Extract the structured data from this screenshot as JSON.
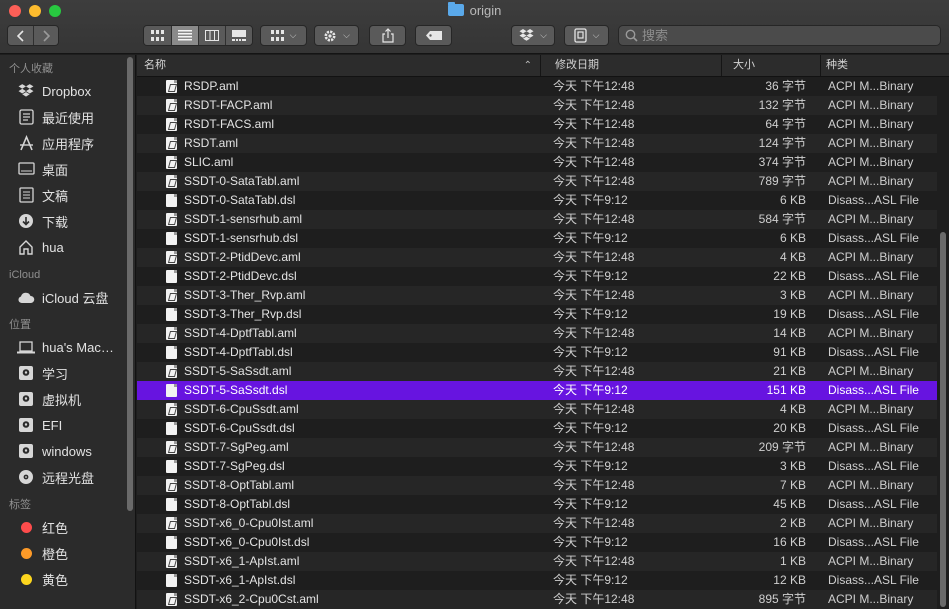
{
  "window": {
    "title": "origin"
  },
  "toolbar": {
    "search_placeholder": "搜索"
  },
  "sidebar": {
    "sections": {
      "favorites": "个人收藏",
      "icloud": "iCloud",
      "locations": "位置",
      "tags": "标签"
    },
    "favorites": [
      {
        "label": "Dropbox",
        "icon": "dropbox-icon"
      },
      {
        "label": "最近使用",
        "icon": "recents-icon"
      },
      {
        "label": "应用程序",
        "icon": "applications-icon"
      },
      {
        "label": "桌面",
        "icon": "desktop-icon"
      },
      {
        "label": "文稿",
        "icon": "documents-icon"
      },
      {
        "label": "下载",
        "icon": "downloads-icon"
      },
      {
        "label": "hua",
        "icon": "home-icon"
      }
    ],
    "icloud": [
      {
        "label": "iCloud 云盘",
        "icon": "cloud-icon"
      }
    ],
    "locations": [
      {
        "label": "hua's Mac…",
        "icon": "laptop-icon"
      },
      {
        "label": "学习",
        "icon": "disk-icon"
      },
      {
        "label": "虚拟机",
        "icon": "disk-icon"
      },
      {
        "label": "EFI",
        "icon": "disk-icon"
      },
      {
        "label": "windows",
        "icon": "disk-icon"
      },
      {
        "label": "远程光盘",
        "icon": "optical-disc-icon"
      }
    ],
    "tags": [
      {
        "label": "红色",
        "color": "#fe4c4c"
      },
      {
        "label": "橙色",
        "color": "#fd9a28"
      },
      {
        "label": "黄色",
        "color": "#fdd61e"
      }
    ]
  },
  "columns": {
    "name": "名称",
    "date": "修改日期",
    "size": "大小",
    "kind": "种类"
  },
  "files": [
    {
      "name": "RSDP.aml",
      "date": "今天 下午12:48",
      "size": "36 字节",
      "kind": "ACPI M...Binary",
      "type": "aml"
    },
    {
      "name": "RSDT-FACP.aml",
      "date": "今天 下午12:48",
      "size": "132 字节",
      "kind": "ACPI M...Binary",
      "type": "aml"
    },
    {
      "name": "RSDT-FACS.aml",
      "date": "今天 下午12:48",
      "size": "64 字节",
      "kind": "ACPI M...Binary",
      "type": "aml"
    },
    {
      "name": "RSDT.aml",
      "date": "今天 下午12:48",
      "size": "124 字节",
      "kind": "ACPI M...Binary",
      "type": "aml"
    },
    {
      "name": "SLIC.aml",
      "date": "今天 下午12:48",
      "size": "374 字节",
      "kind": "ACPI M...Binary",
      "type": "aml"
    },
    {
      "name": "SSDT-0-SataTabl.aml",
      "date": "今天 下午12:48",
      "size": "789 字节",
      "kind": "ACPI M...Binary",
      "type": "aml"
    },
    {
      "name": "SSDT-0-SataTabl.dsl",
      "date": "今天 下午9:12",
      "size": "6 KB",
      "kind": "Disass...ASL File",
      "type": "dsl"
    },
    {
      "name": "SSDT-1-sensrhub.aml",
      "date": "今天 下午12:48",
      "size": "584 字节",
      "kind": "ACPI M...Binary",
      "type": "aml"
    },
    {
      "name": "SSDT-1-sensrhub.dsl",
      "date": "今天 下午9:12",
      "size": "6 KB",
      "kind": "Disass...ASL File",
      "type": "dsl"
    },
    {
      "name": "SSDT-2-PtidDevc.aml",
      "date": "今天 下午12:48",
      "size": "4 KB",
      "kind": "ACPI M...Binary",
      "type": "aml"
    },
    {
      "name": "SSDT-2-PtidDevc.dsl",
      "date": "今天 下午9:12",
      "size": "22 KB",
      "kind": "Disass...ASL File",
      "type": "dsl"
    },
    {
      "name": "SSDT-3-Ther_Rvp.aml",
      "date": "今天 下午12:48",
      "size": "3 KB",
      "kind": "ACPI M...Binary",
      "type": "aml"
    },
    {
      "name": "SSDT-3-Ther_Rvp.dsl",
      "date": "今天 下午9:12",
      "size": "19 KB",
      "kind": "Disass...ASL File",
      "type": "dsl"
    },
    {
      "name": "SSDT-4-DptfTabl.aml",
      "date": "今天 下午12:48",
      "size": "14 KB",
      "kind": "ACPI M...Binary",
      "type": "aml"
    },
    {
      "name": "SSDT-4-DptfTabl.dsl",
      "date": "今天 下午9:12",
      "size": "91 KB",
      "kind": "Disass...ASL File",
      "type": "dsl"
    },
    {
      "name": "SSDT-5-SaSsdt.aml",
      "date": "今天 下午12:48",
      "size": "21 KB",
      "kind": "ACPI M...Binary",
      "type": "aml"
    },
    {
      "name": "SSDT-5-SaSsdt.dsl",
      "date": "今天 下午9:12",
      "size": "151 KB",
      "kind": "Disass...ASL File",
      "type": "dsl",
      "selected": true
    },
    {
      "name": "SSDT-6-CpuSsdt.aml",
      "date": "今天 下午12:48",
      "size": "4 KB",
      "kind": "ACPI M...Binary",
      "type": "aml"
    },
    {
      "name": "SSDT-6-CpuSsdt.dsl",
      "date": "今天 下午9:12",
      "size": "20 KB",
      "kind": "Disass...ASL File",
      "type": "dsl"
    },
    {
      "name": "SSDT-7-SgPeg.aml",
      "date": "今天 下午12:48",
      "size": "209 字节",
      "kind": "ACPI M...Binary",
      "type": "aml"
    },
    {
      "name": "SSDT-7-SgPeg.dsl",
      "date": "今天 下午9:12",
      "size": "3 KB",
      "kind": "Disass...ASL File",
      "type": "dsl"
    },
    {
      "name": "SSDT-8-OptTabl.aml",
      "date": "今天 下午12:48",
      "size": "7 KB",
      "kind": "ACPI M...Binary",
      "type": "aml"
    },
    {
      "name": "SSDT-8-OptTabl.dsl",
      "date": "今天 下午9:12",
      "size": "45 KB",
      "kind": "Disass...ASL File",
      "type": "dsl"
    },
    {
      "name": "SSDT-x6_0-Cpu0Ist.aml",
      "date": "今天 下午12:48",
      "size": "2 KB",
      "kind": "ACPI M...Binary",
      "type": "aml"
    },
    {
      "name": "SSDT-x6_0-Cpu0Ist.dsl",
      "date": "今天 下午9:12",
      "size": "16 KB",
      "kind": "Disass...ASL File",
      "type": "dsl"
    },
    {
      "name": "SSDT-x6_1-ApIst.aml",
      "date": "今天 下午12:48",
      "size": "1 KB",
      "kind": "ACPI M...Binary",
      "type": "aml"
    },
    {
      "name": "SSDT-x6_1-ApIst.dsl",
      "date": "今天 下午9:12",
      "size": "12 KB",
      "kind": "Disass...ASL File",
      "type": "dsl"
    },
    {
      "name": "SSDT-x6_2-Cpu0Cst.aml",
      "date": "今天 下午12:48",
      "size": "895 字节",
      "kind": "ACPI M...Binary",
      "type": "aml"
    }
  ]
}
